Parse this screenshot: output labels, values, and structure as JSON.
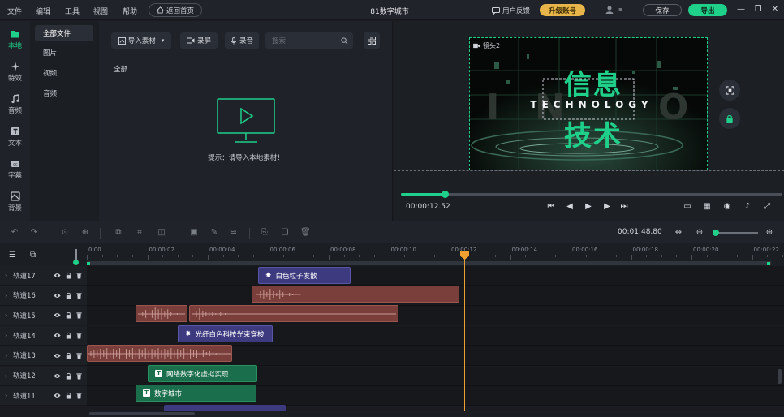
{
  "menu": [
    "文件",
    "编辑",
    "工具",
    "视图",
    "帮助"
  ],
  "home_button": "返回首页",
  "project_title": "81数字城市",
  "feedback": "用户反馈",
  "upgrade": "升级账号",
  "save": "保存",
  "export": "导出",
  "rail": [
    {
      "label": "本地",
      "icon": "folder-icon"
    },
    {
      "label": "特效",
      "icon": "sparkle-icon"
    },
    {
      "label": "音频",
      "icon": "music-icon"
    },
    {
      "label": "文本",
      "icon": "text-icon"
    },
    {
      "label": "字幕",
      "icon": "caption-icon"
    },
    {
      "label": "背景",
      "icon": "background-icon"
    }
  ],
  "categories": [
    "全部文件",
    "图片",
    "视频",
    "音频"
  ],
  "media": {
    "import": "导入素材",
    "record_screen": "录屏",
    "record_audio": "录音",
    "search_placeholder": "搜索",
    "all_label": "全部",
    "empty_hint": "提示：请导入本地素材！"
  },
  "preview": {
    "cam_label": "镜头2",
    "title_top": "信息",
    "title_bottom": "技术",
    "tech_word": "TECHNOLOGY",
    "current_time": "00:00:12.52",
    "progress": 0.115
  },
  "timeline": {
    "total_time": "00:01:48.80",
    "ticks": [
      "0:00",
      "00:00:02",
      "00:00:04",
      "00:00:06",
      "00:00:08",
      "00:00:10",
      "00:00:12",
      "00:00:14",
      "00:00:16",
      "00:00:18",
      "00:00:20",
      "00:00:22"
    ],
    "tracks": [
      {
        "name": "轨道17"
      },
      {
        "name": "轨道16"
      },
      {
        "name": "轨道15"
      },
      {
        "name": "轨道14"
      },
      {
        "name": "轨道13"
      },
      {
        "name": "轨道12"
      },
      {
        "name": "轨道11"
      }
    ],
    "clips": {
      "t17": "白色粒子发散",
      "t14": "光纤白色科技光束穿梭",
      "t12": "网络数字化虚拟实现",
      "t11": "数字城市"
    }
  },
  "colors": {
    "accent": "#1fd08a",
    "upgrade": "#e8b54a",
    "playhead": "#f0a030"
  }
}
